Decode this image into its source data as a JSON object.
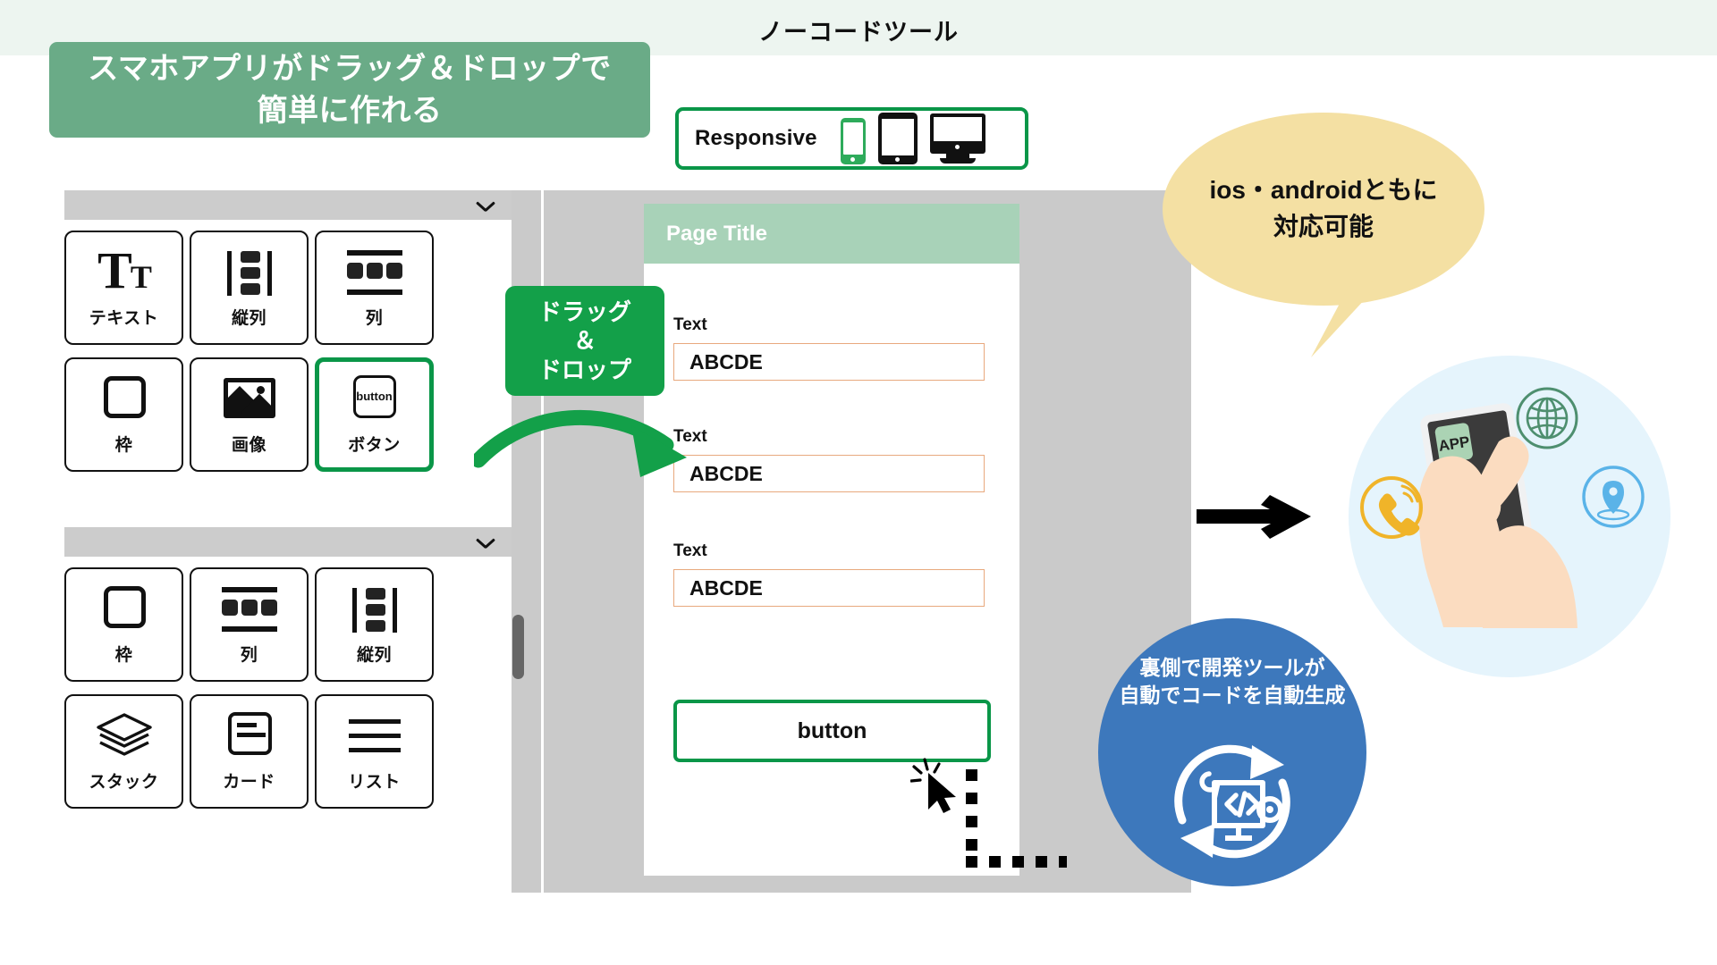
{
  "header": {
    "title": "ノーコードツール",
    "band_color": "#edf5f0"
  },
  "headline": {
    "line1": "スマホアプリがドラッグ＆ドロップで",
    "line2": "簡単に作れる",
    "bg_color": "#6aab87"
  },
  "responsive": {
    "label": "Responsive",
    "border_color": "#0a9648",
    "devices": [
      {
        "name": "phone-icon",
        "color": "#2eab5b"
      },
      {
        "name": "tablet-icon",
        "color": "#111111"
      },
      {
        "name": "monitor-icon",
        "color": "#111111"
      }
    ]
  },
  "palette": {
    "sections": [
      {
        "collapse_icon": "chevron-down-icon",
        "tiles": [
          {
            "id": "text",
            "label": "テキスト",
            "icon": "text-tt-icon",
            "selected": false
          },
          {
            "id": "vertical-column",
            "label": "縦列",
            "icon": "vertical-column-icon",
            "selected": false
          },
          {
            "id": "column",
            "label": "列",
            "icon": "column-icon",
            "selected": false
          },
          {
            "id": "frame",
            "label": "枠",
            "icon": "frame-icon",
            "selected": false
          },
          {
            "id": "image",
            "label": "画像",
            "icon": "image-icon",
            "selected": false
          },
          {
            "id": "button",
            "label": "ボタン",
            "icon": "button-icon",
            "icon_text": "button",
            "selected": true
          }
        ]
      },
      {
        "collapse_icon": "chevron-down-icon",
        "tiles": [
          {
            "id": "frame2",
            "label": "枠",
            "icon": "frame-icon",
            "selected": false
          },
          {
            "id": "column2",
            "label": "列",
            "icon": "column-icon",
            "selected": false
          },
          {
            "id": "vertical-column2",
            "label": "縦列",
            "icon": "vertical-column-icon",
            "selected": false
          },
          {
            "id": "stack",
            "label": "スタック",
            "icon": "stack-icon",
            "selected": false
          },
          {
            "id": "card",
            "label": "カード",
            "icon": "card-icon",
            "selected": false
          },
          {
            "id": "list",
            "label": "リスト",
            "icon": "list-icon",
            "selected": false
          }
        ]
      }
    ]
  },
  "dnd_badge": {
    "line1": "ドラッグ",
    "line2": "＆",
    "line3": "ドロップ",
    "color": "#13a049"
  },
  "preview": {
    "page_title": "Page Title",
    "header_color": "#a8d2b8",
    "fields": [
      {
        "label": "Text",
        "value": "ABCDE"
      },
      {
        "label": "Text",
        "value": "ABCDE"
      },
      {
        "label": "Text",
        "value": "ABCDE"
      }
    ],
    "button_label": "button",
    "button_border_color": "#0a9648",
    "field_border_color": "#e8a97e",
    "cursor_icon": "click-cursor-icon"
  },
  "bubble": {
    "line1": "ios・androidともに",
    "line2": "対応可能",
    "bg_color": "#f4e0a3"
  },
  "blue_circle": {
    "line1": "裏側で開発ツールが",
    "line2": "自動でコードを自動生成",
    "bg_color": "#3d78bc",
    "icon": "code-autogeneration-icon"
  },
  "illustration": {
    "app_label": "APP",
    "disc_color": "#e5f4fc",
    "badges": [
      {
        "name": "phone-call-icon",
        "color": "#f0b429"
      },
      {
        "name": "globe-icon",
        "color": "#4e8f6f"
      },
      {
        "name": "location-pin-icon",
        "color": "#5ab3e8"
      }
    ]
  },
  "flow_arrow": {
    "name": "right-arrow-icon",
    "color": "#000000"
  }
}
